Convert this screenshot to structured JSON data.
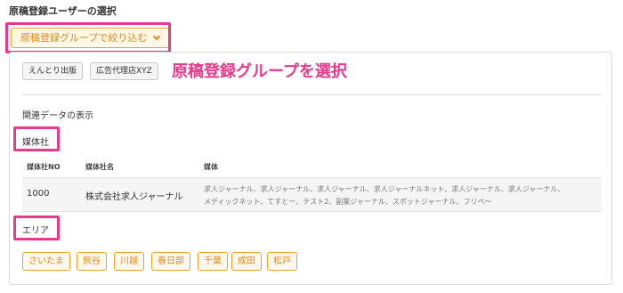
{
  "page_title": "原稿登録ユーザーの選択",
  "group_dropdown": {
    "label": "原稿登録グループで絞り込む"
  },
  "groups": [
    "えんとり出版",
    "広告代理店XYZ"
  ],
  "annotation": "原稿登録グループを選択",
  "related_label": "関連データの表示",
  "media_section": {
    "label": "媒体社",
    "columns": [
      "媒体社NO",
      "媒体社名",
      "媒体"
    ],
    "rows": [
      {
        "no": "1000",
        "name": "株式会社求人ジャーナル",
        "media_line1": "求人ジャーナル、求人ジャーナル、求人ジャーナル、求人ジャーナルネット、求人ジャーナル、求人ジャーナル、",
        "media_line2": "メディックネット、てすとー、テスト2、副業ジャーナル、スポットジャーナル、フリペ〜"
      }
    ]
  },
  "area_section": {
    "label": "エリア",
    "areas": [
      "さいたま",
      "熊谷",
      "川越",
      "春日部",
      "千葉",
      "成田",
      "松戸"
    ]
  },
  "colors": {
    "accent_orange": "#f0a030",
    "highlight_pink": "#e8398c"
  },
  "icons": {
    "dropdown": "chevron-down-icon"
  }
}
